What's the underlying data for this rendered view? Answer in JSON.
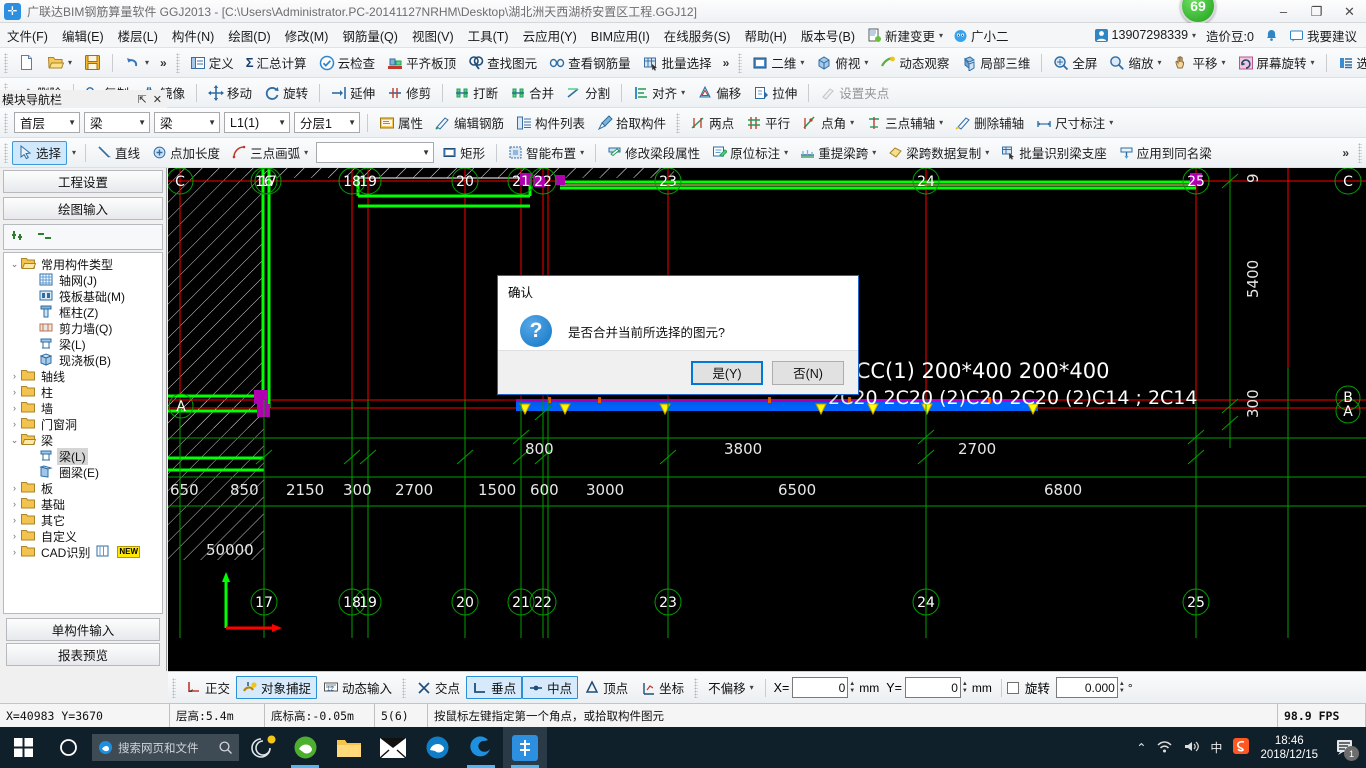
{
  "window": {
    "app_icon": "ggj-logo-icon",
    "title": "广联达BIM钢筋算量软件 GGJ2013 - [C:\\Users\\Administrator.PC-20141127NRHM\\Desktop\\湖北洲天西湖桥安置区工程.GGJ12]",
    "minimize": "–",
    "maximize": "❐",
    "close": "✕",
    "badge": "69"
  },
  "menubar": {
    "items": [
      "文件(F)",
      "编辑(E)",
      "楼层(L)",
      "构件(N)",
      "绘图(D)",
      "修改(M)",
      "钢筋量(Q)",
      "视图(V)",
      "工具(T)",
      "云应用(Y)",
      "BIM应用(I)",
      "在线服务(S)",
      "帮助(H)",
      "版本号(B)"
    ],
    "new_change": "新建变更",
    "assistant": "广小二",
    "account": "13907298339",
    "coins_label": "造价豆:0",
    "feedback": "我要建议"
  },
  "toolbar1": {
    "left_icons": [
      "new-file-icon",
      "open-file-icon",
      "save-icon",
      "undo-icon"
    ],
    "overflow": "»",
    "items": [
      {
        "label": "定义",
        "icon": "define-icon"
      },
      {
        "label": "汇总计算",
        "icon": "sigma-icon"
      },
      {
        "label": "云检查",
        "icon": "cloud-check-icon"
      },
      {
        "label": "平齐板顶",
        "icon": "align-slab-icon"
      },
      {
        "label": "查找图元",
        "icon": "find-element-icon"
      },
      {
        "label": "查看钢筋量",
        "icon": "view-rebar-icon"
      },
      {
        "label": "批量选择",
        "icon": "batch-select-icon"
      }
    ],
    "view_items": [
      {
        "label": "二维",
        "icon": "2d-icon",
        "dropdown": true
      },
      {
        "label": "俯视",
        "icon": "topview-icon",
        "dropdown": true
      },
      {
        "label": "动态观察",
        "icon": "orbit-icon",
        "dropdown": false
      },
      {
        "label": "局部三维",
        "icon": "local3d-icon",
        "dropdown": false
      },
      {
        "label": "全屏",
        "icon": "fullscreen-icon",
        "dropdown": false
      },
      {
        "label": "缩放",
        "icon": "zoom-icon",
        "dropdown": true
      },
      {
        "label": "平移",
        "icon": "pan-icon",
        "dropdown": true
      },
      {
        "label": "屏幕旋转",
        "icon": "screen-rotate-icon",
        "dropdown": true
      },
      {
        "label": "选择楼层",
        "icon": "select-floor-icon",
        "dropdown": false
      }
    ]
  },
  "toolbar2": {
    "items": [
      {
        "label": "删除",
        "icon": "delete-icon"
      },
      {
        "label": "复制",
        "icon": "copy-icon"
      },
      {
        "label": "镜像",
        "icon": "mirror-icon"
      },
      {
        "label": "移动",
        "icon": "move-icon"
      },
      {
        "label": "旋转",
        "icon": "rotate-icon"
      },
      {
        "label": "延伸",
        "icon": "extend-icon"
      },
      {
        "label": "修剪",
        "icon": "trim-icon"
      },
      {
        "label": "打断",
        "icon": "break-icon"
      },
      {
        "label": "合并",
        "icon": "merge-icon"
      },
      {
        "label": "分割",
        "icon": "split-icon"
      },
      {
        "label": "对齐",
        "icon": "align-icon",
        "dropdown": true
      },
      {
        "label": "偏移",
        "icon": "offset-icon"
      },
      {
        "label": "拉伸",
        "icon": "stretch-icon"
      },
      {
        "label": "设置夹点",
        "icon": "set-grip-icon",
        "disabled": true
      }
    ]
  },
  "toolbar3": {
    "combos": [
      {
        "name": "floor",
        "value": "首层"
      },
      {
        "name": "category",
        "value": "梁"
      },
      {
        "name": "subcategory",
        "value": "梁"
      },
      {
        "name": "component",
        "value": "L1(1)"
      },
      {
        "name": "layer",
        "value": "分层1"
      }
    ],
    "items": [
      {
        "label": "属性",
        "icon": "properties-icon"
      },
      {
        "label": "编辑钢筋",
        "icon": "edit-rebar-icon"
      },
      {
        "label": "构件列表",
        "icon": "component-list-icon"
      },
      {
        "label": "拾取构件",
        "icon": "pick-component-icon"
      }
    ],
    "axis_items": [
      {
        "label": "两点",
        "icon": "two-point-icon",
        "dropdown": false
      },
      {
        "label": "平行",
        "icon": "parallel-icon",
        "dropdown": false
      },
      {
        "label": "点角",
        "icon": "point-angle-icon",
        "dropdown": true
      },
      {
        "label": "三点辅轴",
        "icon": "three-point-axis-icon",
        "dropdown": true
      },
      {
        "label": "删除辅轴",
        "icon": "delete-axis-icon",
        "dropdown": false
      },
      {
        "label": "尺寸标注",
        "icon": "dimension-icon",
        "dropdown": true
      }
    ]
  },
  "toolbar4": {
    "select": {
      "label": "选择",
      "icon": "arrow-select-icon"
    },
    "items": [
      {
        "label": "直线",
        "icon": "line-icon",
        "dropdown": false
      },
      {
        "label": "点加长度",
        "icon": "point-length-icon",
        "dropdown": false
      },
      {
        "label": "三点画弧",
        "icon": "three-point-arc-icon",
        "dropdown": true
      }
    ],
    "blank_combo": "",
    "items2": [
      {
        "label": "矩形",
        "icon": "rectangle-icon",
        "dropdown": false
      },
      {
        "label": "智能布置",
        "icon": "smart-layout-icon",
        "dropdown": true
      },
      {
        "label": "修改梁段属性",
        "icon": "edit-beam-seg-icon",
        "dropdown": false
      },
      {
        "label": "原位标注",
        "icon": "in-place-label-icon",
        "dropdown": true
      },
      {
        "label": "重提梁跨",
        "icon": "re-extract-span-icon",
        "dropdown": true
      },
      {
        "label": "梁跨数据复制",
        "icon": "span-data-copy-icon",
        "dropdown": true
      },
      {
        "label": "批量识别梁支座",
        "icon": "batch-recognize-support-icon",
        "dropdown": false
      },
      {
        "label": "应用到同名梁",
        "icon": "apply-same-beam-icon",
        "dropdown": false
      }
    ],
    "overflow": "»"
  },
  "sidebar": {
    "header": "模块导航栏",
    "pin": "⇱",
    "close": "✕",
    "tabs": [
      "工程设置",
      "绘图输入"
    ],
    "tools": [
      "expand-all-icon",
      "collapse-all-icon"
    ],
    "tree": [
      {
        "label": "常用构件类型",
        "depth": 0,
        "expander": "⌄",
        "icon": "folder-open-icon"
      },
      {
        "label": "轴网(J)",
        "depth": 1,
        "icon": "grid-icon"
      },
      {
        "label": "筏板基础(M)",
        "depth": 1,
        "icon": "raft-icon"
      },
      {
        "label": "框柱(Z)",
        "depth": 1,
        "icon": "column-icon"
      },
      {
        "label": "剪力墙(Q)",
        "depth": 1,
        "icon": "shearwall-icon"
      },
      {
        "label": "梁(L)",
        "depth": 1,
        "icon": "beam-icon"
      },
      {
        "label": "现浇板(B)",
        "depth": 1,
        "icon": "slab-icon"
      },
      {
        "label": "轴线",
        "depth": 0,
        "expander": "›",
        "icon": "folder-icon"
      },
      {
        "label": "柱",
        "depth": 0,
        "expander": "›",
        "icon": "folder-icon"
      },
      {
        "label": "墙",
        "depth": 0,
        "expander": "›",
        "icon": "folder-icon"
      },
      {
        "label": "门窗洞",
        "depth": 0,
        "expander": "›",
        "icon": "folder-icon"
      },
      {
        "label": "梁",
        "depth": 0,
        "expander": "⌄",
        "icon": "folder-open-icon"
      },
      {
        "label": "梁(L)",
        "depth": 1,
        "icon": "beam-icon",
        "selected": true
      },
      {
        "label": "圈梁(E)",
        "depth": 1,
        "icon": "ringbeam-icon"
      },
      {
        "label": "板",
        "depth": 0,
        "expander": "›",
        "icon": "folder-icon"
      },
      {
        "label": "基础",
        "depth": 0,
        "expander": "›",
        "icon": "folder-icon"
      },
      {
        "label": "其它",
        "depth": 0,
        "expander": "›",
        "icon": "folder-icon"
      },
      {
        "label": "自定义",
        "depth": 0,
        "expander": "›",
        "icon": "folder-icon"
      },
      {
        "label": "CAD识别",
        "depth": 0,
        "expander": "›",
        "icon": "folder-icon",
        "badge": "NEW"
      }
    ],
    "footer": [
      "单构件输入",
      "报表预览"
    ]
  },
  "canvas": {
    "grid_labels_top": [
      "C",
      "16",
      "17",
      "18",
      "19",
      "20",
      "21",
      "22",
      "23",
      "24",
      "25"
    ],
    "grid_labels_bottom": [
      "17",
      "18",
      "19",
      "20",
      "21",
      "22",
      "23",
      "24",
      "25"
    ],
    "grid_labels_right": [
      "C",
      "B",
      "A"
    ],
    "grid_labels_left": [
      "A"
    ],
    "dim_row_upper": [
      "800",
      "3800",
      "2700"
    ],
    "dim_row_lower": [
      "650",
      "850",
      "2150",
      "300",
      "2700",
      "1500",
      "600",
      "3000",
      "6500",
      "6800"
    ],
    "dim_total": "50000",
    "dim_vertical": [
      "9",
      "5400",
      "300"
    ],
    "beam_labels": [
      "LCC(1)",
      "200*400",
      "200*400",
      "2C14;2C14"
    ],
    "beam_label_overlap": "2C20 2C20 (2)C20 2C20 (2)C14"
  },
  "snapbar": {
    "groups": [
      {
        "label": "正交",
        "icon": "ortho-icon",
        "on": false
      },
      {
        "label": "对象捕捉",
        "icon": "object-snap-icon",
        "on": true
      },
      {
        "label": "动态输入",
        "icon": "dynamic-input-icon",
        "on": false
      }
    ],
    "snaps": [
      {
        "label": "交点",
        "icon": "intersection-icon",
        "on": false
      },
      {
        "label": "垂点",
        "icon": "perpendicular-icon",
        "on": true
      },
      {
        "label": "中点",
        "icon": "midpoint-icon",
        "on": true
      },
      {
        "label": "顶点",
        "icon": "vertex-icon",
        "on": false
      },
      {
        "label": "坐标",
        "icon": "coordinate-icon",
        "on": false
      }
    ],
    "offset_mode": "不偏移",
    "x_label": "X=",
    "x_value": "0",
    "x_unit": "mm",
    "y_label": "Y=",
    "y_value": "0",
    "y_unit": "mm",
    "rotate_label": "旋转",
    "rotate_value": "0.000",
    "degree_unit": "°"
  },
  "statusbar": {
    "coords": "X=40983 Y=3670",
    "floor_height": "层高:5.4m",
    "base_elev": "底标高:-0.05m",
    "selection": "5(6)",
    "hint": "按鼠标左键指定第一个角点，或拾取构件图元",
    "fps": "98.9 FPS"
  },
  "dialog": {
    "title": "确认",
    "icon": "question-icon",
    "message": "是否合并当前所选择的图元?",
    "yes": "是(Y)",
    "no": "否(N)"
  },
  "taskbar": {
    "start": "start-icon",
    "cortana": "cortana-icon",
    "search_placeholder": "搜索网页和文件",
    "search_icon": "search-icon",
    "apps": [
      {
        "name": "spiral-icon",
        "running": false
      },
      {
        "name": "green-browser-icon",
        "running": true
      },
      {
        "name": "file-explorer-icon",
        "running": false
      },
      {
        "name": "mail-icon",
        "running": false
      },
      {
        "name": "edge-icon",
        "running": false
      },
      {
        "name": "blue-swirl-icon",
        "running": true
      },
      {
        "name": "ggj-app-icon",
        "running": true,
        "active": true
      }
    ],
    "tray": {
      "chevron": "⌃",
      "wifi": "wifi-icon",
      "volume": "volume-icon",
      "ime": "中",
      "sogou": "sogou-icon",
      "time": "18:46",
      "date": "2018/12/15",
      "notification_count": "1"
    }
  },
  "colors": {
    "accent": "#0078d7",
    "canvas_bg": "#000000",
    "grid_green": "#00a000",
    "axis_red": "#ff0000",
    "beam_green": "#00ff00",
    "selected_blue": "#0064ff",
    "magenta": "#b000b0",
    "taskbar": "#10202b"
  }
}
